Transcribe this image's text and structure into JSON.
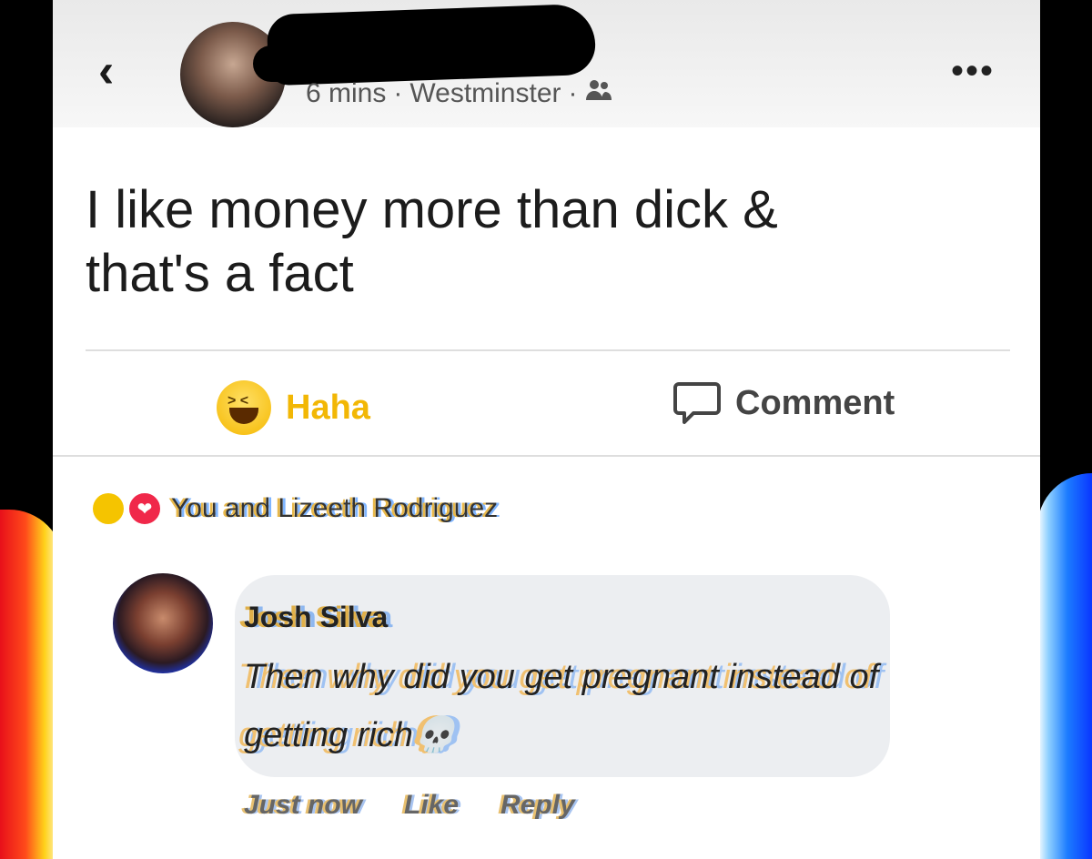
{
  "header": {
    "back_icon": "chevron-left-icon",
    "time": "6 mins",
    "separator": "·",
    "location": "Westminster",
    "audience_icon": "friends-icon",
    "more_icon": "more-icon",
    "more_glyph": "•••"
  },
  "post": {
    "text": "I like money more than dick & that's a fact"
  },
  "actions": {
    "haha_label": "Haha",
    "haha_color": "#f2b705",
    "comment_label": "Comment",
    "comment_color": "#444444"
  },
  "reactions": {
    "text": "You and Lizeeth Rodriguez"
  },
  "comment": {
    "author": "Josh Silva",
    "text": "Then why did you get pregnant instead of getting rich💀",
    "time": "Just now",
    "like_label": "Like",
    "reply_label": "Reply"
  }
}
